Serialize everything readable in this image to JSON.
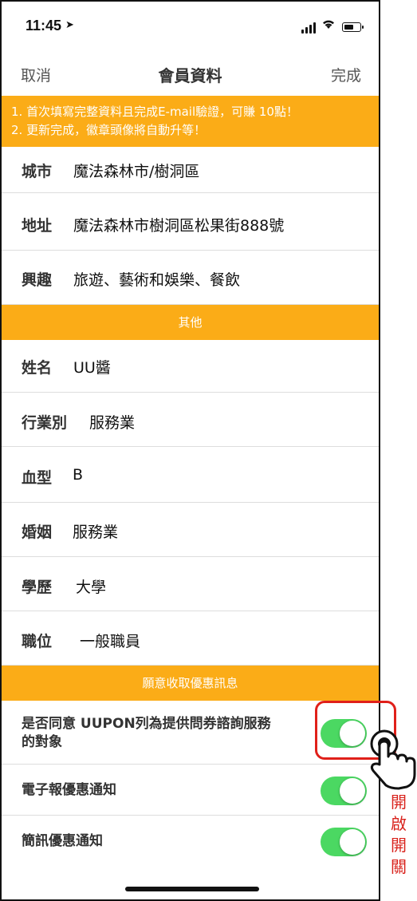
{
  "status": {
    "time": "11:45"
  },
  "nav": {
    "cancel": "取消",
    "title": "會員資料",
    "done": "完成"
  },
  "notice": {
    "line1": "1. 首次填寫完整資料且完成E-mail驗證，可賺 10點！",
    "line2": "2. 更新完成，徽章頭像將自動升等！"
  },
  "address": [
    {
      "label": "城市",
      "value": "魔法森林市/樹洞區"
    },
    {
      "label": "地址",
      "value": "魔法森林市樹洞區松果街888號"
    },
    {
      "label": "興趣",
      "value": "旅遊、藝術和娛樂、餐飲"
    }
  ],
  "other_section": "其他",
  "other": [
    {
      "label": "姓名",
      "value": "UU醬"
    },
    {
      "label": "行業別",
      "value": "服務業"
    },
    {
      "label": "血型",
      "value": "B"
    },
    {
      "label": "婚姻",
      "value": "服務業"
    },
    {
      "label": "學歷",
      "value": "大學"
    },
    {
      "label": "職位",
      "value": "一般職員"
    }
  ],
  "promo_section": "願意收取優惠訊息",
  "promo": [
    {
      "label_line1": "是否同意 UUPON列為提供問券諮詢服務",
      "label_line2": "的對象",
      "on": true
    },
    {
      "label": "電子報優惠通知",
      "on": true
    },
    {
      "label": "簡訊優惠通知",
      "on": true
    }
  ],
  "annotation": [
    "開",
    "啟",
    "開",
    "關"
  ],
  "colors": {
    "accent": "#fbac17",
    "toggle_on": "#4bd862",
    "annotation": "#e0201a"
  }
}
